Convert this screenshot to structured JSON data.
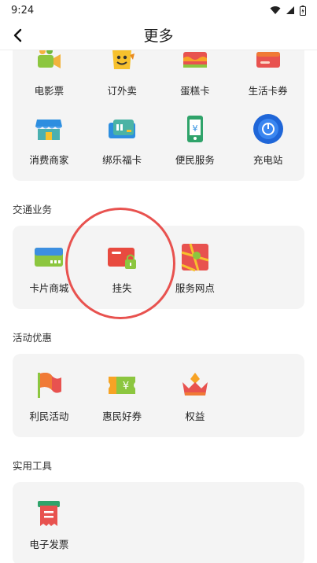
{
  "status": {
    "time": "9:24"
  },
  "header": {
    "title": "更多"
  },
  "top_card": {
    "items": [
      {
        "label": "电影票",
        "icon": "movie-camera-icon"
      },
      {
        "label": "订外卖",
        "icon": "takeaway-icon"
      },
      {
        "label": "蛋糕卡",
        "icon": "cake-card-icon"
      },
      {
        "label": "生活卡券",
        "icon": "life-coupon-icon"
      },
      {
        "label": "消费商家",
        "icon": "shop-icon"
      },
      {
        "label": "绑乐福卡",
        "icon": "bind-card-icon"
      },
      {
        "label": "便民服务",
        "icon": "phone-service-icon"
      },
      {
        "label": "充电站",
        "icon": "charging-station-icon"
      }
    ]
  },
  "sections": [
    {
      "title": "交通业务",
      "items": [
        {
          "label": "卡片商城",
          "icon": "card-store-icon"
        },
        {
          "label": "挂失",
          "icon": "report-loss-icon"
        },
        {
          "label": "服务网点",
          "icon": "service-map-icon"
        }
      ]
    },
    {
      "title": "活动优惠",
      "items": [
        {
          "label": "利民活动",
          "icon": "flag-icon"
        },
        {
          "label": "惠民好券",
          "icon": "coupon-icon"
        },
        {
          "label": "权益",
          "icon": "crown-icon"
        }
      ]
    },
    {
      "title": "实用工具",
      "items": [
        {
          "label": "电子发票",
          "icon": "invoice-icon"
        }
      ]
    }
  ],
  "colors": {
    "accent_red": "#e8524f",
    "card_bg": "#f4f4f4"
  }
}
